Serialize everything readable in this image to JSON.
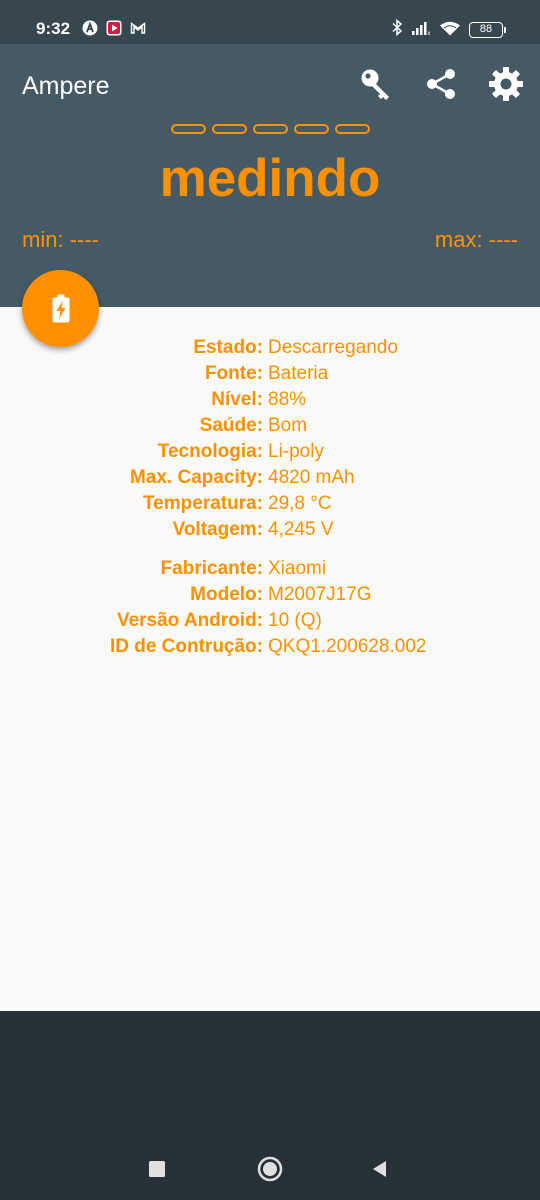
{
  "status_bar": {
    "time": "9:32",
    "battery_level": "88",
    "notification_icons": [
      "a-circle-icon",
      "red-play-icon",
      "gmail-icon"
    ],
    "system_icons": [
      "bluetooth-icon",
      "signal-icon",
      "wifi-icon",
      "battery-icon"
    ]
  },
  "app_bar": {
    "title": "Ampere",
    "actions": [
      "key-icon",
      "share-icon",
      "settings-icon"
    ]
  },
  "meter": {
    "reading": "medindo",
    "min": "min: ----",
    "max": "max: ----",
    "dashes_count_shown": 5
  },
  "battery_info": [
    {
      "label": "Estado:",
      "value": "Descarregando"
    },
    {
      "label": "Fonte:",
      "value": "Bateria"
    },
    {
      "label": "Nível:",
      "value": "88%"
    },
    {
      "label": "Saúde:",
      "value": "Bom"
    },
    {
      "label": "Tecnologia:",
      "value": "Li-poly"
    },
    {
      "label": "Max. Capacity:",
      "value": "4820 mAh"
    },
    {
      "label": "Temperatura:",
      "value": "29,8 °C"
    },
    {
      "label": "Voltagem:",
      "value": "4,245 V"
    }
  ],
  "device_info": [
    {
      "label": "Fabricante:",
      "value": "Xiaomi"
    },
    {
      "label": "Modelo:",
      "value": "M2007J17G"
    },
    {
      "label": "Versão Android:",
      "value": "10 (Q)"
    },
    {
      "label": "ID de Contrução:",
      "value": "QKQ1.200628.002"
    }
  ],
  "colors": {
    "accent": "#ff9100",
    "header": "#455a64",
    "status_bar": "#37474f",
    "content_bg": "#fafafa",
    "nav_bar": "#263238"
  }
}
